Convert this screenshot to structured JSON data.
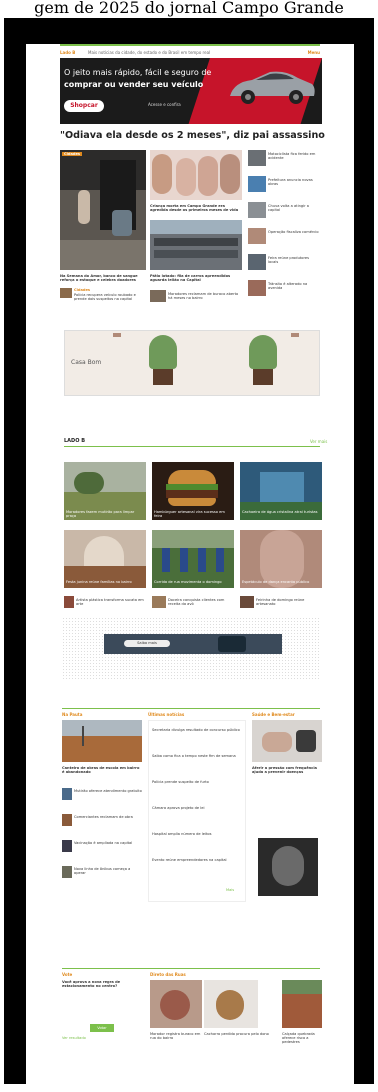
{
  "caption": "gem de 2025 do jornal Campo Grande",
  "nav": {
    "label": "Lado B",
    "tagline": "Mais notícias da cidade, do estado e do Brasil em tempo real",
    "menu": "Menu"
  },
  "banner": {
    "line1": "O jeito mais rápido, fácil e seguro de",
    "line2": "comprar ou vender seu veículo",
    "logo": "Shopcar",
    "cta": "Acesse e confira"
  },
  "headline": "\"Odiava ela desde os 2 meses\", diz pai assassino",
  "colors": {
    "accent": "#e08a1e",
    "green": "#7cc04b",
    "ad_red": "#c6142a"
  },
  "main": {
    "lead_tag": "Cidades",
    "lead_title": "Na Semana do Amor, banco de sangue reforça o estoque e celebra doadores",
    "lead_sub": "Cidades",
    "lead_sub_title": "Polícia recupera veículo roubado e prende dois suspeitos na capital",
    "mid1_title": "Criança morta em Campo Grande era agredida desde os primeiros meses de vida",
    "mid2_title": "Pátio lotado: fila de carros apreendidos aguarda leilão na Capital",
    "mid3_title": "Moradores reclamam de buraco aberto há meses no bairro",
    "side": [
      "Motociclista fica ferido em acidente",
      "Prefeitura anuncia novas obras",
      "Chuva volta a atingir a capital",
      "Operação fiscaliza comércio",
      "Feira reúne produtores locais",
      "Trânsito é alterado na avenida"
    ]
  },
  "ad_mid": {
    "brand": "Casa Bom"
  },
  "ladob": {
    "title": "LADO B",
    "more": "Ver mais",
    "items": [
      "Moradores fazem mutirão para limpar praça",
      "Hambúrguer artesanal vira sucesso em feira",
      "Cachoeira de água cristalina atrai turistas",
      "Festa junina reúne famílias no bairro",
      "Corrida de rua movimenta o domingo",
      "Espetáculo de dança encanta público"
    ],
    "small": [
      "Artista plástica transforma sucata em arte",
      "Doceira conquista clientes com receita da avó",
      "Feirinha de domingo reúne artesanato"
    ]
  },
  "ad_bar": {
    "pill": "Saiba mais"
  },
  "columns": {
    "col1_head": "Na Pauta",
    "col1_title": "Canteiro de obras de escola em bairro é abandonado",
    "col1_items": [
      "Mutirão oferece atendimento gratuito",
      "Comerciantes reclamam de obra",
      "Vacinação é ampliada na capital",
      "Nova linha de ônibus começa a operar"
    ],
    "col2_head": "Últimas notícias",
    "col2_items": [
      "Secretaria divulga resultado de concurso público",
      "Saiba como fica o tempo neste fim de semana",
      "Polícia prende suspeito de furto",
      "Câmara aprova projeto de lei",
      "Hospital amplia número de leitos",
      "Evento reúne empreendedores na capital"
    ],
    "col2_more": "Mais",
    "col3_head": "Saúde e Bem-estar",
    "col3_title": "Aferir a pressão com frequência ajuda a prevenir doenças"
  },
  "vote": {
    "head": "Vote",
    "question": "Você aprova a nova regra de estacionamento no centro?",
    "button": "Votar",
    "link": "Ver resultado"
  },
  "direto": {
    "head": "Direto das Ruas",
    "items": [
      "Morador registra buraco em rua do bairro",
      "Cachorro perdido procura pelo dono",
      "Calçada quebrada oferece risco a pedestres"
    ]
  }
}
